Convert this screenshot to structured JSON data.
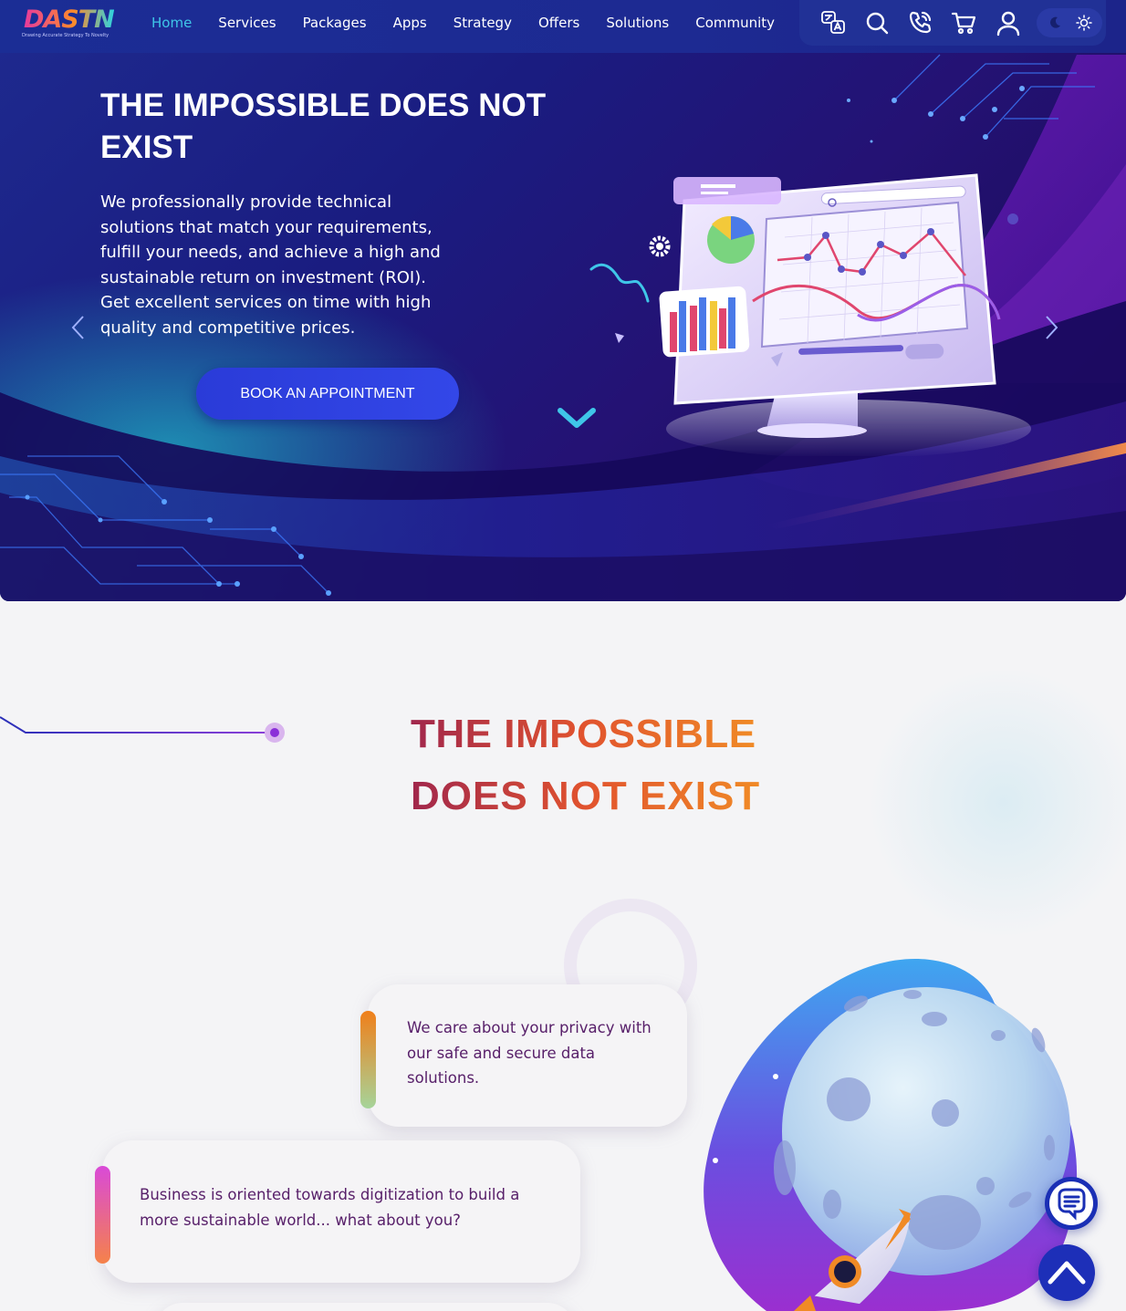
{
  "brand": {
    "logo_text": "DASTN",
    "tagline": "Drawing Accurate Strategy To Novelty"
  },
  "nav": {
    "items": [
      {
        "label": "Home",
        "active": true
      },
      {
        "label": "Services"
      },
      {
        "label": "Packages"
      },
      {
        "label": "Apps"
      },
      {
        "label": "Strategy"
      },
      {
        "label": "Offers"
      },
      {
        "label": "Solutions"
      },
      {
        "label": "Community"
      }
    ],
    "icons": [
      "translate-icon",
      "search-icon",
      "phone-icon",
      "cart-icon",
      "user-icon",
      "moon-icon",
      "sun-icon"
    ]
  },
  "hero": {
    "title": "THE IMPOSSIBLE DOES NOT EXIST",
    "text": "We professionally provide technical solutions that match your requirements, fulfill your needs, and achieve a high and sustainable return on investment (ROI). Get excellent services on time with high quality and competitive prices.",
    "cta_label": "BOOK AN APPOINTMENT"
  },
  "section2": {
    "title_bold": "THE IMPOSSIBLE",
    "title_light": "DOES NOT EXIST",
    "cards": [
      {
        "text": "We care about your privacy with our safe and secure data solutions."
      },
      {
        "text": "Business is oriented towards digitization to build a more sustainable world... what about you?"
      }
    ]
  },
  "colors": {
    "nav_active": "#3fc6e8",
    "hero_bg": "#1e2a8f",
    "cta": "#2a3bd8",
    "title_gradient": [
      "#a0264c",
      "#e1532e",
      "#f08a26"
    ],
    "card_text": "#58206a",
    "float_button": "#1a2fb5"
  }
}
